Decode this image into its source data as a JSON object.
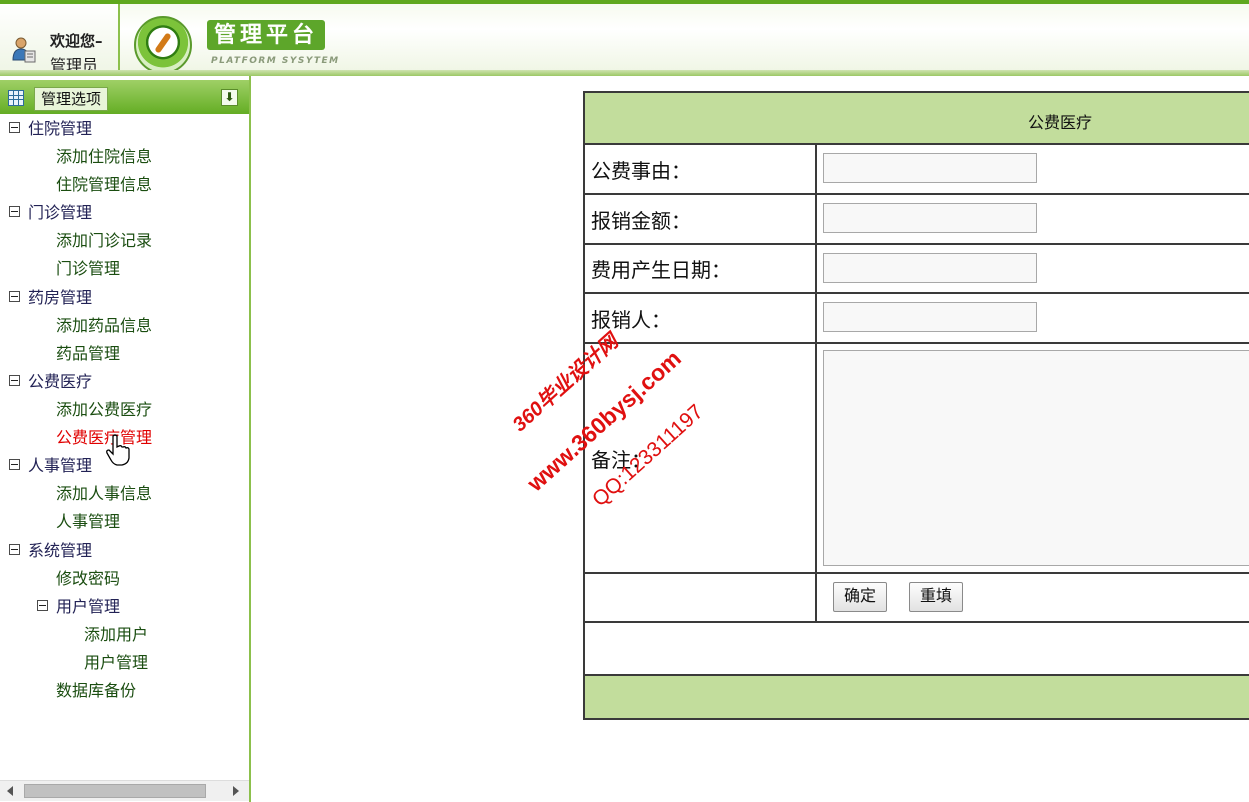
{
  "header": {
    "welcome": "欢迎您–",
    "role": "管理员",
    "platform_title": "管理平台",
    "platform_subtitle": "PLATFORM SYSYTEM"
  },
  "sidebar": {
    "title": "管理选项",
    "toggle_glyph": "⬇",
    "tree": [
      {
        "label": "住院管理",
        "type": "group"
      },
      {
        "label": "添加住院信息",
        "type": "leaf"
      },
      {
        "label": "住院管理信息",
        "type": "leaf"
      },
      {
        "label": "门诊管理",
        "type": "group"
      },
      {
        "label": "添加门诊记录",
        "type": "leaf"
      },
      {
        "label": "门诊管理",
        "type": "leaf"
      },
      {
        "label": "药房管理",
        "type": "group"
      },
      {
        "label": "添加药品信息",
        "type": "leaf"
      },
      {
        "label": "药品管理",
        "type": "leaf"
      },
      {
        "label": "公费医疗",
        "type": "group"
      },
      {
        "label": "添加公费医疗",
        "type": "leaf"
      },
      {
        "label": "公费医疗管理",
        "type": "leaf",
        "active": true
      },
      {
        "label": "人事管理",
        "type": "group"
      },
      {
        "label": "添加人事信息",
        "type": "leaf"
      },
      {
        "label": "人事管理",
        "type": "leaf"
      },
      {
        "label": "系统管理",
        "type": "group"
      },
      {
        "label": "修改密码",
        "type": "leaf"
      },
      {
        "label": "用户管理",
        "type": "subgroup"
      },
      {
        "label": "添加用户",
        "type": "subleaf"
      },
      {
        "label": "用户管理",
        "type": "subleaf"
      },
      {
        "label": "数据库备份",
        "type": "leaf"
      }
    ]
  },
  "form": {
    "title": "公费医疗",
    "fields": [
      {
        "label": "公费事由：",
        "value": ""
      },
      {
        "label": "报销金额：",
        "value": ""
      },
      {
        "label": "费用产生日期：",
        "value": ""
      },
      {
        "label": "报销人：",
        "value": ""
      }
    ],
    "remark_label": "备注：",
    "remark_value": "",
    "submit_label": "确定",
    "reset_label": "重填"
  },
  "watermark": {
    "line1": "360毕业设计网",
    "line2": "www.360bysj.com",
    "line3": "QQ:123311197"
  },
  "colors": {
    "accent": "#64ad24",
    "table_header": "#c2dd9c",
    "active_link": "#e00000"
  }
}
